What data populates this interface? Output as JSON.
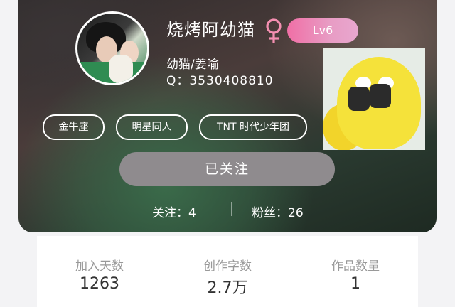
{
  "profile": {
    "username": "烧烤阿幼猫",
    "level": "Lv6",
    "alias": "幼猫/姜喻",
    "qq": "Q：3530408810",
    "tags": [
      "金牛座",
      "明星同人",
      "TNT 时代少年团"
    ],
    "follow_button_label": "已关注",
    "following_label": "关注：",
    "following_count": "4",
    "fans_label": "粉丝：",
    "fans_count": "26"
  },
  "stats": [
    {
      "label": "加入天数",
      "value": "1263"
    },
    {
      "label": "创作字数",
      "value": "2.7万"
    },
    {
      "label": "作品数量",
      "value": "1"
    }
  ],
  "colors": {
    "gender": "#f48fb1",
    "level_badge": "#f06fa6",
    "follow_button": "#8f8b8e"
  },
  "icons": {
    "gender": "female-symbol-icon"
  }
}
